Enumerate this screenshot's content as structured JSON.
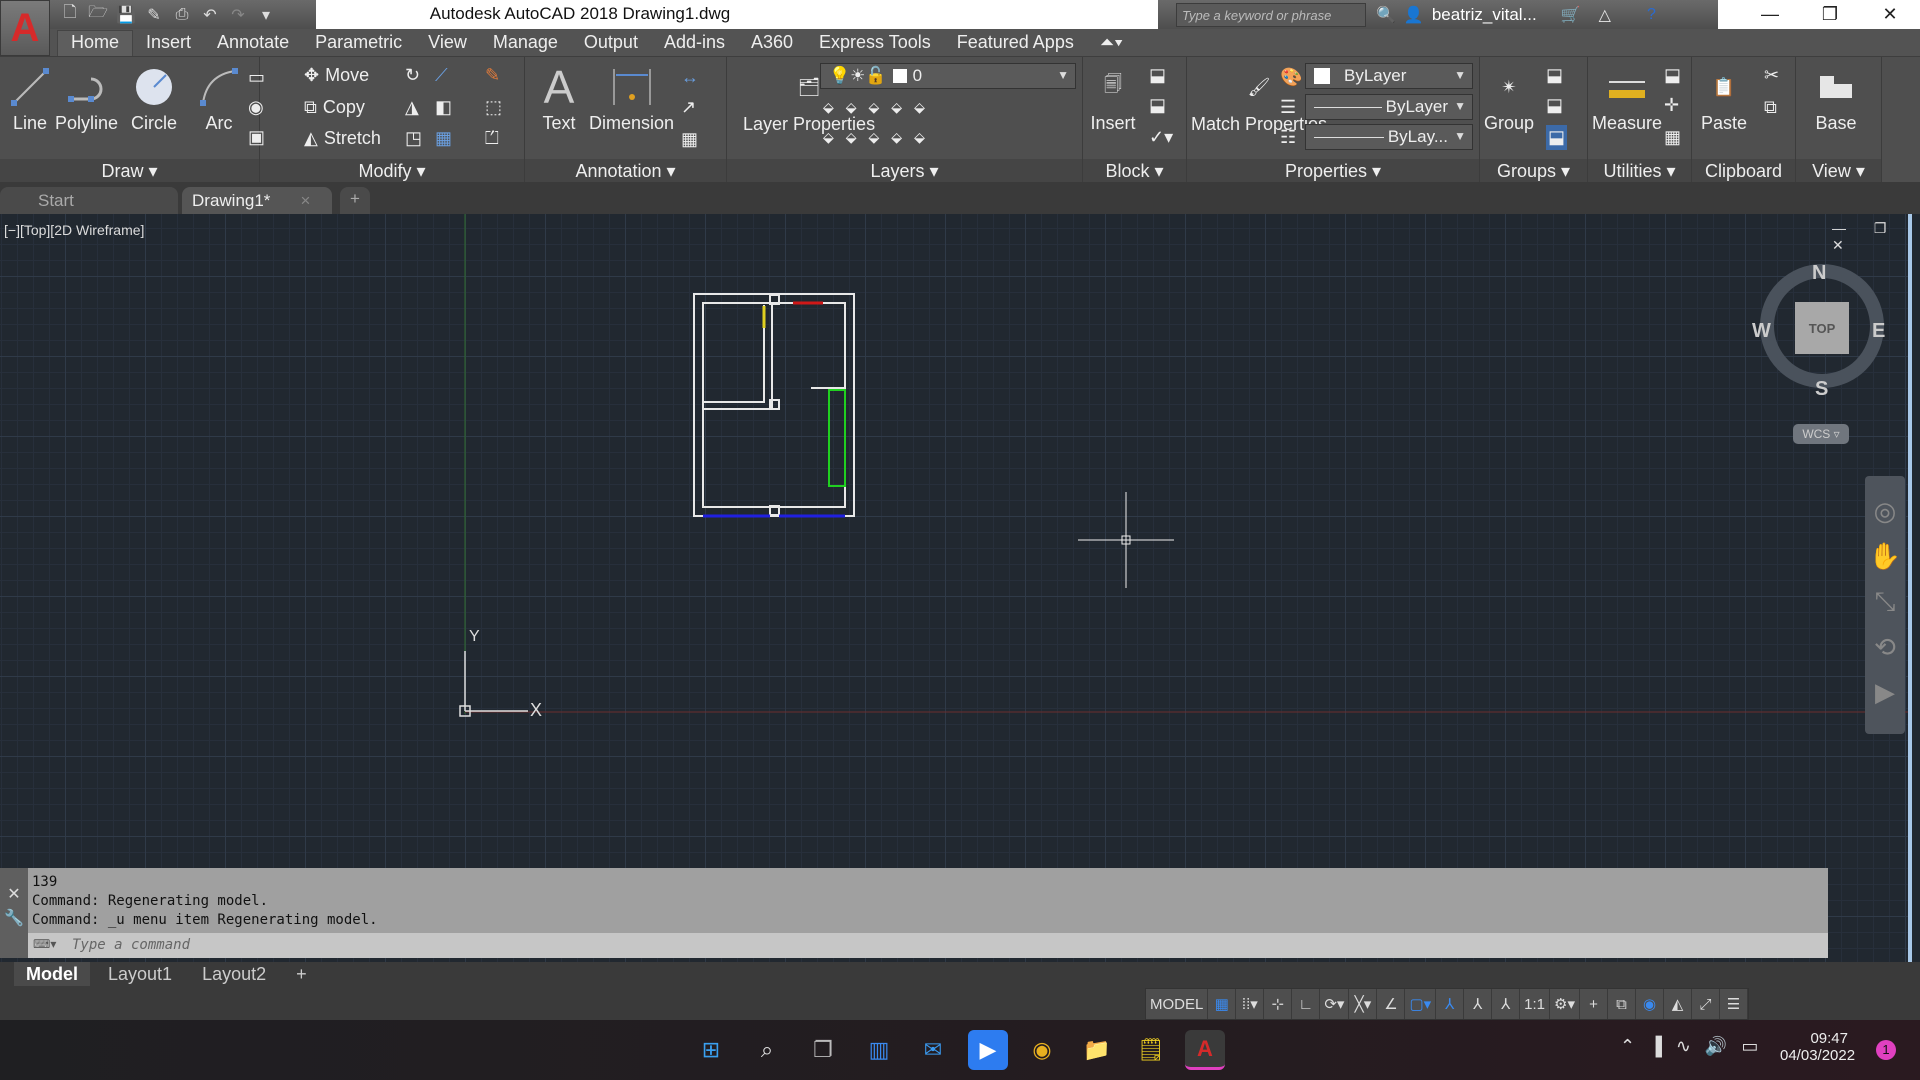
{
  "window": {
    "title": "Autodesk AutoCAD 2018    Drawing1.dwg",
    "app_logo": "A",
    "search_placeholder": "Type a keyword or phrase",
    "user": "beatriz_vital...",
    "minimize": "—",
    "restore": "❐",
    "close": "✕"
  },
  "quick_access": [
    "new-icon",
    "open-icon",
    "save-icon",
    "saveas-icon",
    "print-icon",
    "undo-icon",
    "redo-icon",
    "customize-icon"
  ],
  "ribbon_tabs": [
    "Home",
    "Insert",
    "Annotate",
    "Parametric",
    "View",
    "Manage",
    "Output",
    "Add-ins",
    "A360",
    "Express Tools",
    "Featured Apps"
  ],
  "active_tab": "Home",
  "panels": {
    "draw": {
      "label": "Draw ▾",
      "line": "Line",
      "polyline": "Polyline",
      "circle": "Circle",
      "arc": "Arc"
    },
    "modify": {
      "label": "Modify ▾",
      "move": "Move",
      "copy": "Copy",
      "stretch": "Stretch"
    },
    "annotation": {
      "label": "Annotation ▾",
      "text": "Text",
      "dimension": "Dimension"
    },
    "layers": {
      "label": "Layers ▾",
      "layer_properties": "Layer Properties",
      "current_layer": "0"
    },
    "block": {
      "label": "Block ▾",
      "insert": "Insert"
    },
    "properties": {
      "label": "Properties ▾",
      "match": "Match Properties",
      "color": "ByLayer",
      "lineweight": "ByLayer",
      "linetype": "ByLay..."
    },
    "groups": {
      "label": "Groups ▾",
      "group": "Group"
    },
    "utilities": {
      "label": "Utilities ▾",
      "measure": "Measure"
    },
    "clipboard": {
      "label": "Clipboard",
      "paste": "Paste"
    },
    "view": {
      "label": "View ▾",
      "base": "Base"
    }
  },
  "doc_tabs": [
    {
      "label": "Start"
    },
    {
      "label": "Drawing1*",
      "close": "×"
    }
  ],
  "new_tab": "+",
  "viewport": {
    "label": "[−][Top][2D Wireframe]",
    "viewcube": {
      "n": "N",
      "s": "S",
      "e": "E",
      "w": "W",
      "face": "TOP",
      "ucs": "WCS ▿"
    },
    "ucs_x": "X",
    "ucs_y": "Y"
  },
  "command": {
    "history": [
      "139",
      "Command:  Regenerating model.",
      "Command: _u menu item Regenerating model."
    ],
    "placeholder": "Type a command"
  },
  "layout_tabs": [
    "Model",
    "Layout1",
    "Layout2",
    "+"
  ],
  "status": {
    "model": "MODEL",
    "scale": "1:1"
  },
  "taskbar": {
    "time": "09:47",
    "date": "04/03/2022",
    "notifications": "1"
  }
}
